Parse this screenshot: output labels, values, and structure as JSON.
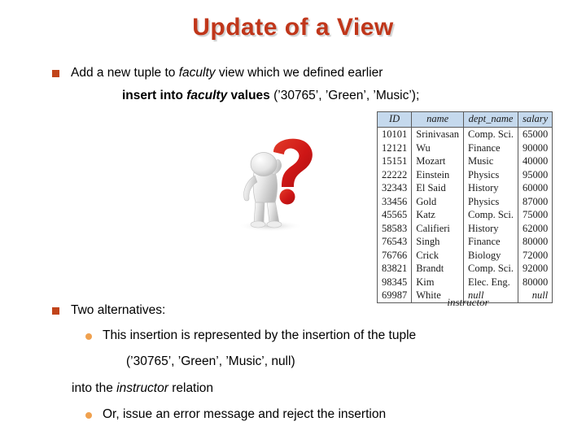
{
  "slide": {
    "title": "Update of a View",
    "title_color": "#C0361A",
    "bullet_square_color": "#C1441A",
    "bullet_dot_color": "#F0A14F",
    "background_color": "#FFFFFF"
  },
  "bullets": {
    "b1_pre": "Add a new tuple to ",
    "b1_em": "faculty",
    "b1_post": " view which we defined earlier",
    "sql_kw1": "insert into",
    "sql_rel": "faculty",
    "sql_kw2": "values",
    "sql_tail": "(’30765’, ’Green’, ’Music’);",
    "b2": "Two alternatives:",
    "s1": "This insertion is represented by the insertion of the tuple",
    "tuple_line": "(’30765’, ’Green’, ’Music’, null)",
    "into_pre": "into the ",
    "into_em": "instructor",
    "into_post": " relation",
    "s2": "Or, issue an error message and reject the insertion"
  },
  "table": {
    "caption": "instructor",
    "header_bg": "#C5D9ED",
    "columns": [
      "ID",
      "name",
      "dept_name",
      "salary"
    ],
    "rows": [
      [
        "10101",
        "Srinivasan",
        "Comp. Sci.",
        "65000"
      ],
      [
        "12121",
        "Wu",
        "Finance",
        "90000"
      ],
      [
        "15151",
        "Mozart",
        "Music",
        "40000"
      ],
      [
        "22222",
        "Einstein",
        "Physics",
        "95000"
      ],
      [
        "32343",
        "El Said",
        "History",
        "60000"
      ],
      [
        "33456",
        "Gold",
        "Physics",
        "87000"
      ],
      [
        "45565",
        "Katz",
        "Comp. Sci.",
        "75000"
      ],
      [
        "58583",
        "Califieri",
        "History",
        "62000"
      ],
      [
        "76543",
        "Singh",
        "Finance",
        "80000"
      ],
      [
        "76766",
        "Crick",
        "Biology",
        "72000"
      ],
      [
        "83821",
        "Brandt",
        "Comp. Sci.",
        "92000"
      ],
      [
        "98345",
        "Kim",
        "Elec. Eng.",
        "80000"
      ],
      [
        "69987",
        "White",
        "null",
        "null"
      ]
    ]
  },
  "clipart": {
    "name": "person-with-question-mark",
    "question_mark_color": "#D32020",
    "figure_color": "#D9D9D9"
  }
}
